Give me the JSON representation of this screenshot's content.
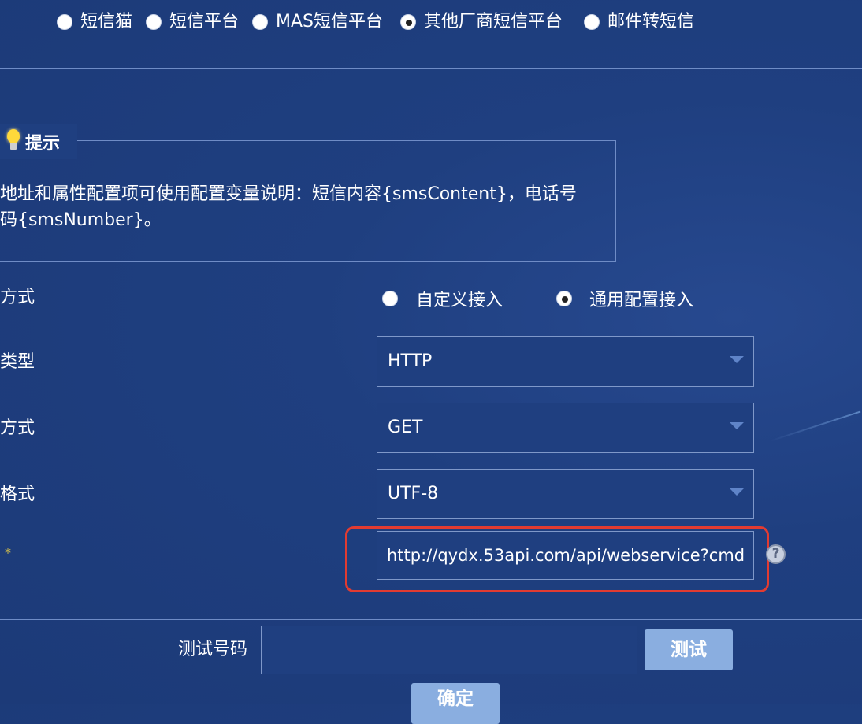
{
  "platform_options": [
    {
      "label": "短信猫",
      "checked": false
    },
    {
      "label": "短信平台",
      "checked": false
    },
    {
      "label": "MAS短信平台",
      "checked": false
    },
    {
      "label": "其他厂商短信平台",
      "checked": true
    },
    {
      "label": "邮件转短信",
      "checked": false
    }
  ],
  "tip": {
    "title": "提示",
    "text": "地址和属性配置项可使用配置变量说明：短信内容{smsContent}，电话号码{smsNumber}。"
  },
  "access": {
    "label": "方式",
    "options": [
      {
        "label": "自定义接入",
        "checked": false
      },
      {
        "label": "通用配置接入",
        "checked": true
      }
    ]
  },
  "fields": {
    "type": {
      "label": "类型",
      "value": "HTTP"
    },
    "method": {
      "label": "方式",
      "value": "GET"
    },
    "encoding": {
      "label": "格式",
      "value": "UTF-8"
    },
    "url": {
      "label": "*",
      "value": "http://qydx.53api.com/api/webservice?cmd"
    }
  },
  "test": {
    "label": "测试号码",
    "value": "",
    "button": "测试"
  },
  "confirm_button": "确定",
  "colors": {
    "background": "#1f3f80",
    "highlight": "#e23b31",
    "button": "#8aaee0",
    "required": "#d8c24a"
  }
}
